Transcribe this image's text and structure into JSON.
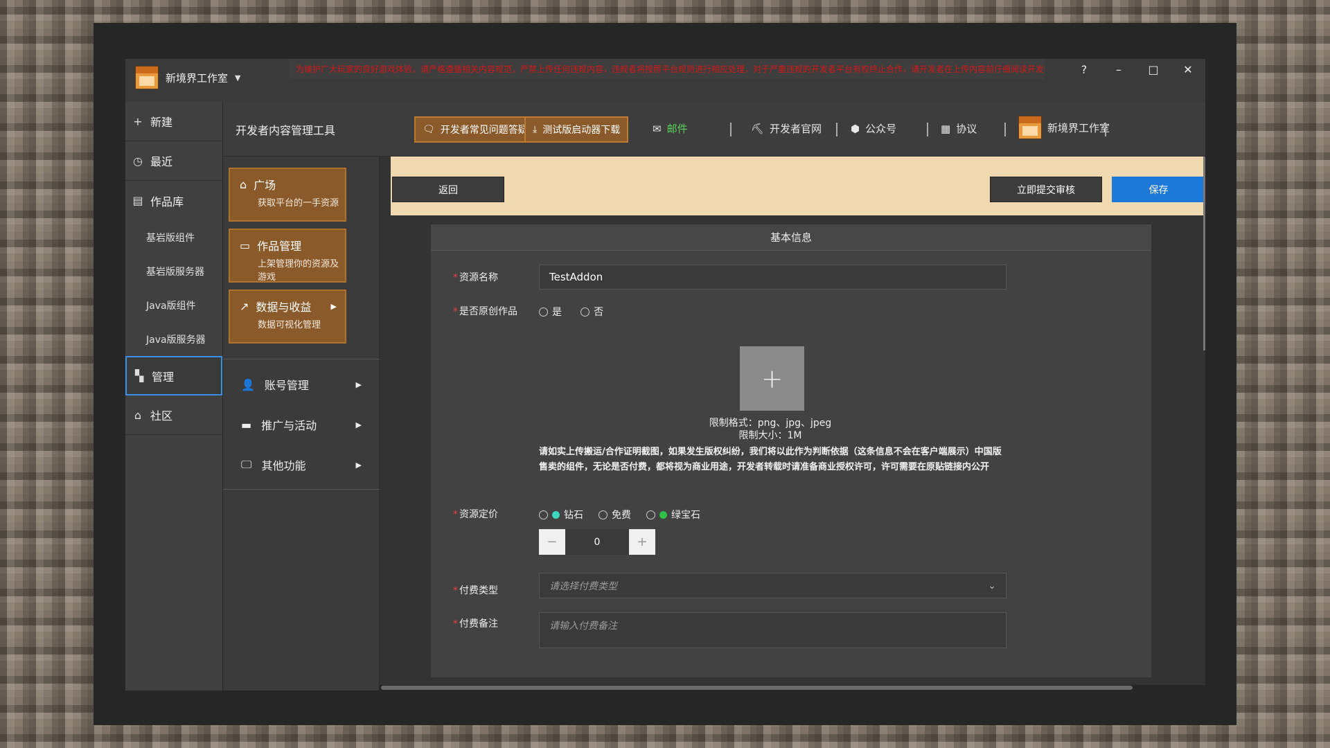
{
  "app": {
    "brand": "新境界工作室",
    "notice": "为维护广大玩家的良好游戏体验，请严格遵循相关内容规范，严禁上传任何违规内容，违规者将按照平台规则进行相应处理，对于严重违规的开发者平台有权终止合作，请开发者在上传内容前仔细阅读开发者协议并严格遵守相关规定。"
  },
  "window": {
    "help": "?",
    "minimize": "–",
    "maximize": "□",
    "close": "✕"
  },
  "sidebar": {
    "new": "新建",
    "recent": "最近",
    "library": "作品库",
    "sub": [
      "基岩版组件",
      "基岩版服务器",
      "Java版组件",
      "Java版服务器"
    ],
    "manage": "管理",
    "community": "社区"
  },
  "header": {
    "title": "开发者内容管理工具",
    "faq": "开发者常见问题答疑",
    "download": "测试版启动器下载",
    "mail": "邮件",
    "site": "开发者官网",
    "wechat": "公众号",
    "protocol": "协议",
    "studio": "新境界工作室"
  },
  "subnav": {
    "cards": [
      {
        "title": "广场",
        "desc": "获取平台的一手资源"
      },
      {
        "title": "作品管理",
        "desc": "上架管理你的资源及游戏"
      },
      {
        "title": "数据与收益",
        "desc": "数据可视化管理"
      }
    ],
    "rows": [
      "账号管理",
      "推广与活动",
      "其他功能"
    ]
  },
  "actions": {
    "back": "返回",
    "submit": "立即提交审核",
    "save": "保存"
  },
  "form": {
    "panel_title": "基本信息",
    "name_label": "资源名称",
    "name_value": "TestAddon",
    "original_label": "是否原创作品",
    "yes": "是",
    "no": "否",
    "upload_formats": "限制格式：png、jpg、jpeg",
    "upload_size": "限制大小：1M",
    "upload_notice": "请如实上传搬运/合作证明截图，如果发生版权纠纷，我们将以此作为判断依据（这条信息不会在客户端展示）中国版售卖的组件，无论是否付费，都将视为商业用途，开发者转载时请准备商业授权许可，许可需要在原贴链接内公开",
    "price_label": "资源定价",
    "diamond": "钻石",
    "free": "免费",
    "emerald": "绿宝石",
    "price_value": "0",
    "minus": "−",
    "plus": "+",
    "paytype_label": "付费类型",
    "paytype_placeholder": "请选择付费类型",
    "paynote_label": "付费备注",
    "paynote_placeholder": "请输入付费备注"
  },
  "colors": {
    "accent": "#1e78d8",
    "brown": "#8a5a2a",
    "banner": "#f0d9b0",
    "required": "#e24040",
    "diamond": "#3fd6c0",
    "emerald": "#2fbf4a"
  }
}
